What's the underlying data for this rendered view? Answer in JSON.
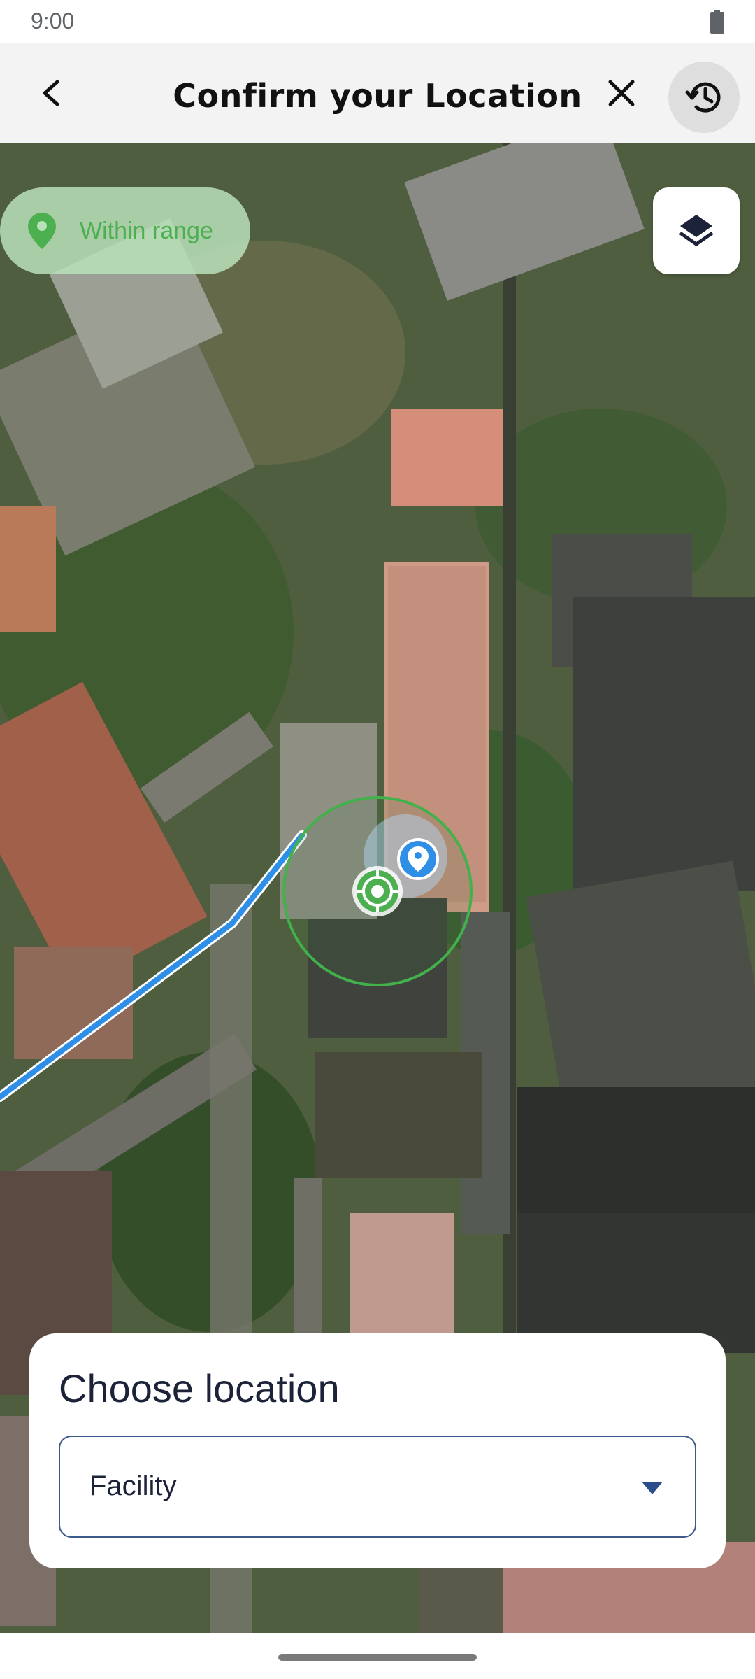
{
  "status_bar": {
    "time": "9:00",
    "battery_icon": "battery-full-icon"
  },
  "app_bar": {
    "title": "Confirm your Location",
    "back_icon": "chevron-left-icon",
    "close_icon": "close-icon",
    "history_icon": "history-icon"
  },
  "map": {
    "range_chip": {
      "label": "Within range",
      "icon": "location-pin-icon",
      "color": "#4caf50"
    },
    "layers_icon": "layers-icon",
    "markers": [
      "user-location-marker",
      "facility-pin-marker"
    ],
    "route_color": "#2f8ee5",
    "range_circle_color": "#43b14b"
  },
  "sheet": {
    "title": "Choose location",
    "select": {
      "value": "Facility",
      "icon": "dropdown-caret-icon"
    }
  }
}
